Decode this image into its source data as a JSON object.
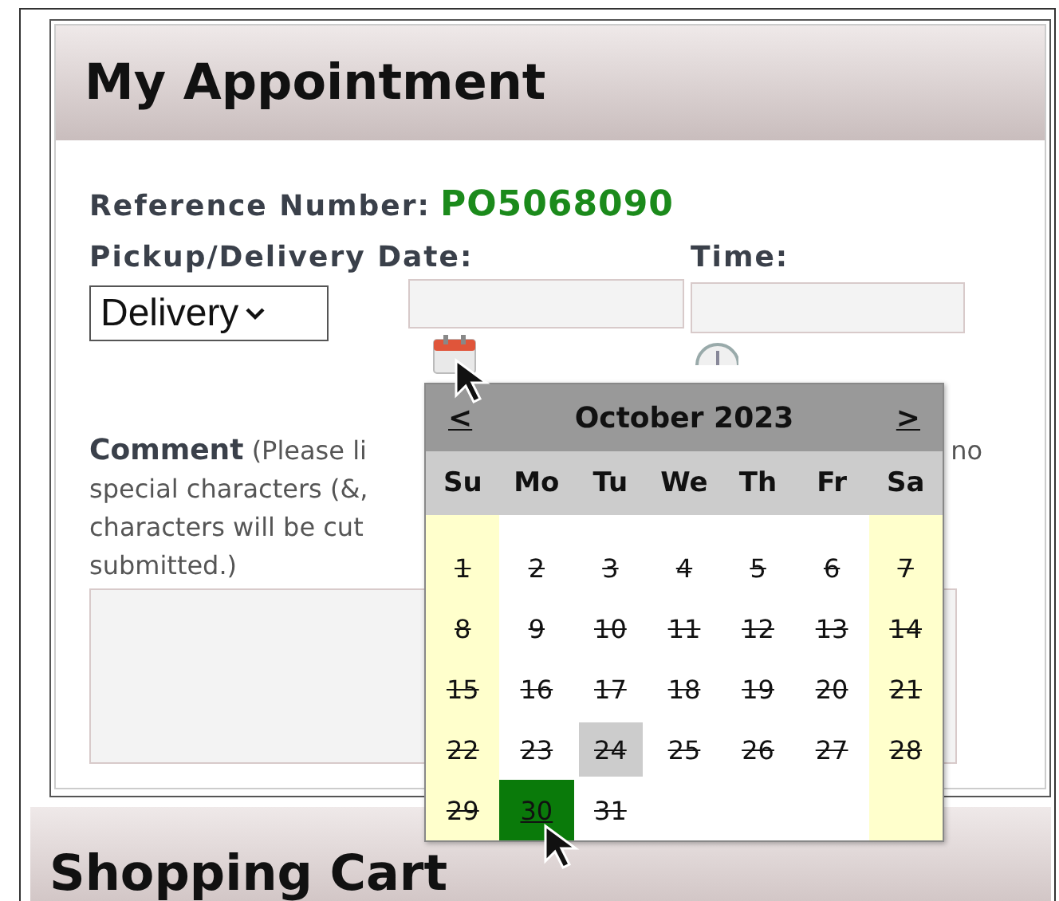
{
  "appointment": {
    "title": "My Appointment",
    "reference_label": "Reference Number:",
    "reference_value": "PO5068090",
    "date_label": "Pickup/Delivery Date:",
    "time_label": "Time:",
    "mode_select": {
      "value": "Delivery"
    },
    "comment": {
      "label": "Comment",
      "lines": [
        "(Please li",
        "special characters (&,",
        "characters will be cut",
        "submitted.)"
      ],
      "line_1_end": "no"
    }
  },
  "calendar": {
    "month": "October 2023",
    "prev": "<",
    "next": ">",
    "weekdays": [
      "Su",
      "Mo",
      "Tu",
      "We",
      "Th",
      "Fr",
      "Sa"
    ],
    "days": [
      {
        "label": "1",
        "disabled": true,
        "today": false,
        "selected": false
      },
      {
        "label": "2",
        "disabled": true,
        "today": false,
        "selected": false
      },
      {
        "label": "3",
        "disabled": true,
        "today": false,
        "selected": false
      },
      {
        "label": "4",
        "disabled": true,
        "today": false,
        "selected": false
      },
      {
        "label": "5",
        "disabled": true,
        "today": false,
        "selected": false
      },
      {
        "label": "6",
        "disabled": true,
        "today": false,
        "selected": false
      },
      {
        "label": "7",
        "disabled": true,
        "today": false,
        "selected": false
      },
      {
        "label": "8",
        "disabled": true,
        "today": false,
        "selected": false
      },
      {
        "label": "9",
        "disabled": true,
        "today": false,
        "selected": false
      },
      {
        "label": "10",
        "disabled": true,
        "today": false,
        "selected": false
      },
      {
        "label": "11",
        "disabled": true,
        "today": false,
        "selected": false
      },
      {
        "label": "12",
        "disabled": true,
        "today": false,
        "selected": false
      },
      {
        "label": "13",
        "disabled": true,
        "today": false,
        "selected": false
      },
      {
        "label": "14",
        "disabled": true,
        "today": false,
        "selected": false
      },
      {
        "label": "15",
        "disabled": true,
        "today": false,
        "selected": false
      },
      {
        "label": "16",
        "disabled": true,
        "today": false,
        "selected": false
      },
      {
        "label": "17",
        "disabled": true,
        "today": false,
        "selected": false
      },
      {
        "label": "18",
        "disabled": true,
        "today": false,
        "selected": false
      },
      {
        "label": "19",
        "disabled": true,
        "today": false,
        "selected": false
      },
      {
        "label": "20",
        "disabled": true,
        "today": false,
        "selected": false
      },
      {
        "label": "21",
        "disabled": true,
        "today": false,
        "selected": false
      },
      {
        "label": "22",
        "disabled": true,
        "today": false,
        "selected": false
      },
      {
        "label": "23",
        "disabled": true,
        "today": false,
        "selected": false
      },
      {
        "label": "24",
        "disabled": true,
        "today": true,
        "selected": false
      },
      {
        "label": "25",
        "disabled": true,
        "today": false,
        "selected": false
      },
      {
        "label": "26",
        "disabled": true,
        "today": false,
        "selected": false
      },
      {
        "label": "27",
        "disabled": true,
        "today": false,
        "selected": false
      },
      {
        "label": "28",
        "disabled": true,
        "today": false,
        "selected": false
      },
      {
        "label": "29",
        "disabled": true,
        "today": false,
        "selected": false
      },
      {
        "label": "30",
        "disabled": false,
        "today": false,
        "selected": true
      },
      {
        "label": "31",
        "disabled": true,
        "today": false,
        "selected": false
      }
    ]
  },
  "cart": {
    "title": "Shopping Cart"
  }
}
